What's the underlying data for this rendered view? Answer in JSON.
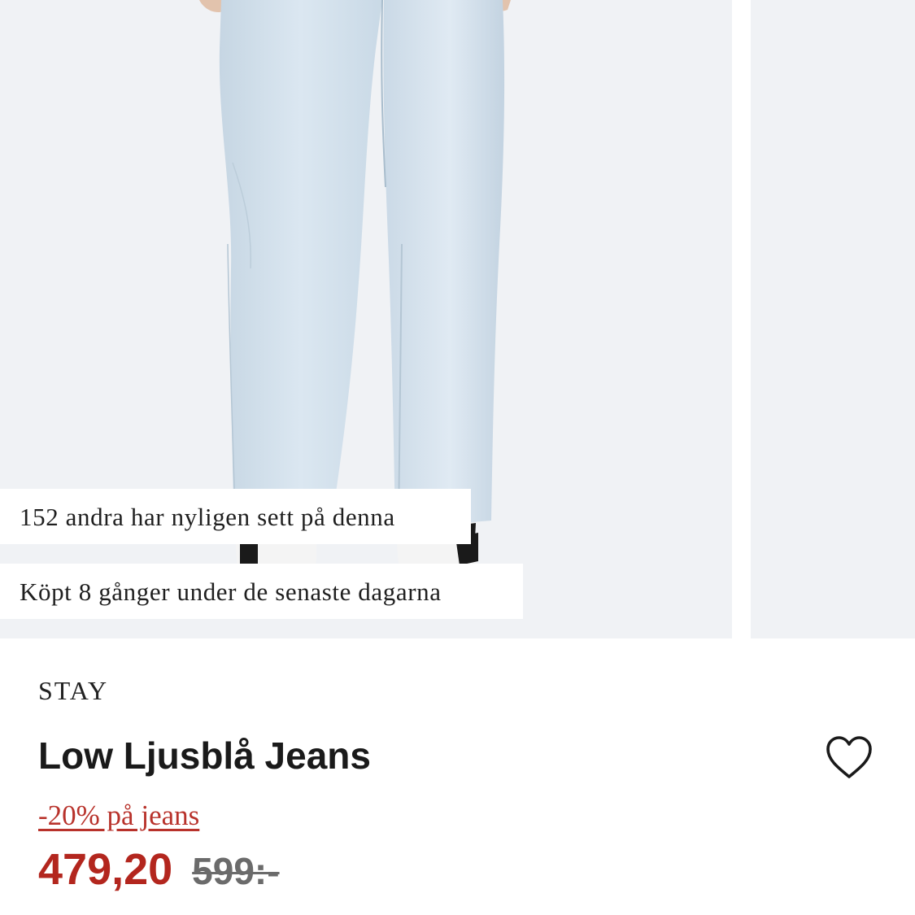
{
  "gallery": {
    "image_icon": "product-photo-jeans",
    "badges": {
      "viewed": "152 andra har nyligen sett på denna",
      "bought": "Köpt 8 gånger under de senaste dagarna"
    }
  },
  "product": {
    "brand": "STAY",
    "title": "Low Ljusblå Jeans",
    "promo": "-20% på jeans",
    "price_sale": "479,20",
    "price_original": "599:-",
    "wishlist_icon": "heart-outline-icon"
  },
  "colors": {
    "sale": "#b3261e",
    "promo": "#b8322b",
    "original_price": "#6b6b6b",
    "image_bg": "#f0f2f5"
  }
}
